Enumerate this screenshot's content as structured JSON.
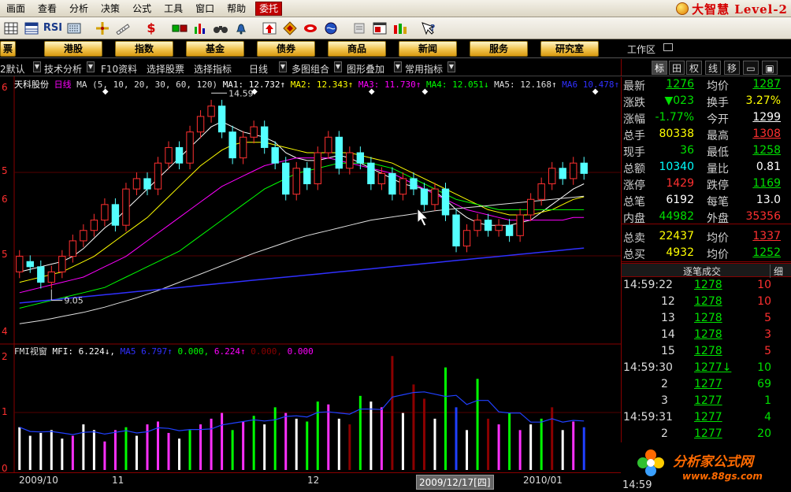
{
  "menu": {
    "items": [
      "画面",
      "查看",
      "分析",
      "决策",
      "公式",
      "工具",
      "窗口",
      "帮助"
    ],
    "active_item": "委托"
  },
  "brand": {
    "name": "大智慧 Level-2"
  },
  "toolbar": {
    "rsi_label": "RSI",
    "dollar_label": "$",
    "icons": [
      "grid-icon",
      "table-icon",
      "rsi-icon",
      "keyboard-icon",
      "crosshair-icon",
      "ruler-icon",
      "dollar-icon",
      "boxes-icon",
      "bar-chart-icon",
      "binoculars-icon",
      "bell-icon",
      "arrow-up-icon",
      "diamond-icon",
      "leaf-icon",
      "globe-icon",
      "notepad-icon",
      "window-icon",
      "stacked-bars-icon",
      "help-icon"
    ]
  },
  "nav": {
    "left_label": "票",
    "categories": [
      "港股",
      "指数",
      "基金",
      "债券",
      "商品",
      "新闻",
      "服务",
      "研究室"
    ],
    "workspace_label": "工作区"
  },
  "funcbar": {
    "items": [
      "2默认",
      "技术分析",
      "F10资料",
      "选择股票",
      "选择指标",
      "日线",
      "多图组合",
      "图形叠加",
      "常用指标"
    ]
  },
  "right_tabs": [
    "标",
    "田",
    "权",
    "线",
    "移"
  ],
  "chart_header": {
    "stock_name": "天科股份",
    "period": "日线",
    "ma_params": "MA (5, 10, 20, 30, 60, 120)",
    "ma1": "MA1: 12.732↑",
    "ma2": "MA2: 12.343↑",
    "ma3": "MA3: 11.730↑",
    "ma4": "MA4: 12.051↓",
    "ma5": "MA5: 12.168↑",
    "ma6": "MA6  10.478↑",
    "high_label": "14.59",
    "low_label": "9.05",
    "colors": {
      "ma1": "#ffffff",
      "ma2": "#ffff00",
      "ma3": "#ff00ff",
      "ma4": "#00ff00",
      "ma5": "#e0e0e0",
      "ma6": "#3030ff"
    }
  },
  "y_axis_labels": [
    "6",
    "5",
    "6",
    "5",
    "4"
  ],
  "volume_header": {
    "name": "FMI视窗",
    "mfi": "MFI: 6.224↓,",
    "ma5": "MA5  6.797↑",
    "v1": "0.000,",
    "v2": "6.224↑",
    "v3": "0.000,",
    "v4": "0.000"
  },
  "volume_axis_labels": [
    "2",
    "1",
    "0"
  ],
  "dates": {
    "labels": [
      "2009/10",
      "11",
      "12",
      "2010/01"
    ],
    "cursor": "2009/12/17[四]"
  },
  "quote": {
    "rows": [
      {
        "l1": "最新",
        "v1": "1276",
        "c1": "green",
        "l2": "均价",
        "v2": "1287",
        "c2": "green"
      },
      {
        "l1": "涨跌",
        "v1": "▼023",
        "c1": "green",
        "l2": "换手",
        "v2": "3.27%",
        "c2": "yellow"
      },
      {
        "l1": "涨幅",
        "v1": "-1.77%",
        "c1": "green",
        "l2": "今开",
        "v2": "1299",
        "c2": "white"
      },
      {
        "l1": "总手",
        "v1": "80338",
        "c1": "yellow",
        "l2": "最高",
        "v2": "1308",
        "c2": "red"
      },
      {
        "l1": "现手",
        "v1": "36",
        "c1": "green",
        "l2": "最低",
        "v2": "1258",
        "c2": "green"
      },
      {
        "l1": "总额",
        "v1": "10340",
        "c1": "cyan",
        "l2": "量比",
        "v2": "0.81",
        "c2": "white"
      },
      {
        "l1": "涨停",
        "v1": "1429",
        "c1": "red",
        "l2": "跌停",
        "v2": "1169",
        "c2": "green"
      },
      {
        "l1": "总笔",
        "v1": "6192",
        "c1": "white",
        "l2": "每笔",
        "v2": "13.0",
        "c2": "white"
      },
      {
        "l1": "内盘",
        "v1": "44982",
        "c1": "green",
        "l2": "外盘",
        "v2": "35356",
        "c2": "red"
      },
      {
        "l1": "总卖",
        "v1": "22437",
        "c1": "yellow",
        "l2": "均价",
        "v2": "1337",
        "c2": "red"
      },
      {
        "l1": "总买",
        "v1": "4932",
        "c1": "yellow",
        "l2": "均价",
        "v2": "1252",
        "c2": "green"
      }
    ]
  },
  "ticks": {
    "title": "逐笔成交",
    "detail": "细",
    "rows": [
      {
        "time": "14:59:22",
        "price": "1278",
        "vol": "10",
        "vc": "red"
      },
      {
        "time": "12",
        "price": "1278",
        "vol": "10",
        "vc": "red"
      },
      {
        "time": "13",
        "price": "1278",
        "vol": "5",
        "vc": "red"
      },
      {
        "time": "14",
        "price": "1278",
        "vol": "3",
        "vc": "red"
      },
      {
        "time": "15",
        "price": "1278",
        "vol": "5",
        "vc": "red"
      },
      {
        "time": "14:59:30",
        "price": "1277↓",
        "vol": "10",
        "vc": "green"
      },
      {
        "time": "2",
        "price": "1277",
        "vol": "69",
        "vc": "green"
      },
      {
        "time": "3",
        "price": "1277",
        "vol": "1",
        "vc": "green"
      },
      {
        "time": "14:59:31",
        "price": "1277",
        "vol": "4",
        "vc": "green"
      },
      {
        "time": "2",
        "price": "1277",
        "vol": "20",
        "vc": "green"
      }
    ],
    "bottom_time": "14:59"
  },
  "watermark": {
    "title": "分析家公式网",
    "url": "www.88gs.com"
  },
  "chart_data": {
    "type": "candlestick",
    "candles": [
      {
        "o": 11.3,
        "c": 11.6
      },
      {
        "o": 11.5,
        "c": 11.4
      },
      {
        "o": 11.4,
        "c": 11.1
      },
      {
        "o": 11.1,
        "c": 11.3
      },
      {
        "o": 11.3,
        "c": 11.6
      },
      {
        "o": 11.6,
        "c": 11.9
      },
      {
        "o": 11.9,
        "c": 12.1
      },
      {
        "o": 12.1,
        "c": 12.3
      },
      {
        "o": 12.3,
        "c": 12.6
      },
      {
        "o": 12.6,
        "c": 12.2
      },
      {
        "o": 12.2,
        "c": 12.9
      },
      {
        "o": 12.9,
        "c": 13.1
      },
      {
        "o": 13.1,
        "c": 12.9
      },
      {
        "o": 12.9,
        "c": 13.4
      },
      {
        "o": 13.4,
        "c": 13.7
      },
      {
        "o": 13.7,
        "c": 13.4
      },
      {
        "o": 13.4,
        "c": 14.0
      },
      {
        "o": 14.0,
        "c": 14.3
      },
      {
        "o": 14.3,
        "c": 14.5
      },
      {
        "o": 14.5,
        "c": 14.0
      },
      {
        "o": 14.0,
        "c": 13.5
      },
      {
        "o": 13.5,
        "c": 13.9
      },
      {
        "o": 13.9,
        "c": 14.1
      },
      {
        "o": 14.1,
        "c": 13.7
      },
      {
        "o": 13.7,
        "c": 13.4
      },
      {
        "o": 13.4,
        "c": 12.8
      },
      {
        "o": 12.8,
        "c": 13.3
      },
      {
        "o": 13.3,
        "c": 13.0
      },
      {
        "o": 13.0,
        "c": 13.6
      },
      {
        "o": 13.6,
        "c": 13.9
      },
      {
        "o": 13.9,
        "c": 13.3
      },
      {
        "o": 13.3,
        "c": 13.6
      },
      {
        "o": 13.6,
        "c": 13.4
      },
      {
        "o": 13.4,
        "c": 13.0
      },
      {
        "o": 13.0,
        "c": 13.2
      },
      {
        "o": 13.2,
        "c": 12.8
      },
      {
        "o": 12.8,
        "c": 13.1
      },
      {
        "o": 13.1,
        "c": 12.9
      },
      {
        "o": 12.9,
        "c": 12.6
      },
      {
        "o": 12.6,
        "c": 12.9
      },
      {
        "o": 12.9,
        "c": 12.4
      },
      {
        "o": 12.4,
        "c": 11.8
      },
      {
        "o": 11.8,
        "c": 12.1
      },
      {
        "o": 12.1,
        "c": 12.3
      },
      {
        "o": 12.3,
        "c": 12.1
      },
      {
        "o": 12.1,
        "c": 12.2
      },
      {
        "o": 12.2,
        "c": 12.0
      },
      {
        "o": 12.0,
        "c": 12.4
      },
      {
        "o": 12.4,
        "c": 12.7
      },
      {
        "o": 12.7,
        "c": 13.0
      },
      {
        "o": 13.0,
        "c": 13.3
      },
      {
        "o": 13.3,
        "c": 13.1
      },
      {
        "o": 13.1,
        "c": 13.4
      },
      {
        "o": 13.4,
        "c": 13.2
      }
    ],
    "ma_lines": [
      {
        "name": "MA1",
        "color": "#ffffff",
        "values": [
          11.3,
          11.35,
          11.4,
          11.45,
          11.5,
          11.6,
          11.75,
          11.95,
          12.15,
          12.3,
          12.5,
          12.7,
          12.9,
          13.1,
          13.3,
          13.5,
          13.7,
          13.9,
          14.1,
          14.2,
          14.1,
          14.0,
          13.95,
          13.9,
          13.8,
          13.6,
          13.5,
          13.45,
          13.45,
          13.5,
          13.55,
          13.5,
          13.4,
          13.3,
          13.2,
          13.1,
          13.0,
          12.95,
          12.9,
          12.85,
          12.7,
          12.5,
          12.35,
          12.25,
          12.2,
          12.2,
          12.2,
          12.25,
          12.3,
          12.45,
          12.6,
          12.75,
          12.9,
          13.0
        ]
      },
      {
        "name": "MA2",
        "color": "#ffff00",
        "values": [
          11.1,
          11.15,
          11.2,
          11.25,
          11.3,
          11.4,
          11.5,
          11.6,
          11.75,
          11.9,
          12.05,
          12.2,
          12.35,
          12.55,
          12.75,
          12.95,
          13.15,
          13.35,
          13.5,
          13.65,
          13.75,
          13.8,
          13.8,
          13.8,
          13.75,
          13.7,
          13.65,
          13.6,
          13.6,
          13.6,
          13.6,
          13.6,
          13.55,
          13.5,
          13.45,
          13.4,
          13.3,
          13.2,
          13.1,
          13.0,
          12.9,
          12.8,
          12.7,
          12.6,
          12.5,
          12.45,
          12.4,
          12.4,
          12.4,
          12.45,
          12.5,
          12.6,
          12.7,
          12.75
        ]
      },
      {
        "name": "MA3",
        "color": "#ff00ff",
        "values": [
          10.9,
          10.95,
          11.0,
          11.05,
          11.1,
          11.15,
          11.2,
          11.3,
          11.4,
          11.5,
          11.6,
          11.75,
          11.9,
          12.05,
          12.2,
          12.35,
          12.5,
          12.65,
          12.8,
          12.95,
          13.05,
          13.15,
          13.25,
          13.35,
          13.4,
          13.45,
          13.5,
          13.5,
          13.5,
          13.5,
          13.45,
          13.4,
          13.35,
          13.3,
          13.25,
          13.2,
          13.1,
          13.0,
          12.9,
          12.8,
          12.7,
          12.6,
          12.5,
          12.45,
          12.4,
          12.35,
          12.3,
          12.3,
          12.3,
          12.3,
          12.3,
          12.3,
          12.35,
          12.35
        ]
      },
      {
        "name": "MA4",
        "color": "#00ff00",
        "values": [
          10.6,
          10.65,
          10.7,
          10.75,
          10.8,
          10.85,
          10.9,
          10.95,
          11.0,
          11.1,
          11.2,
          11.3,
          11.4,
          11.5,
          11.6,
          11.7,
          11.85,
          12.0,
          12.15,
          12.3,
          12.45,
          12.6,
          12.75,
          12.9,
          13.0,
          13.1,
          13.2,
          13.25,
          13.3,
          13.35,
          13.4,
          13.4,
          13.4,
          13.4,
          13.35,
          13.3,
          13.2,
          13.1,
          13.0,
          12.9,
          12.8,
          12.7,
          12.65,
          12.6,
          12.55,
          12.5,
          12.5,
          12.5,
          12.5,
          12.5,
          12.5,
          12.5,
          12.5,
          12.5
        ]
      },
      {
        "name": "MA5",
        "color": "#e0e0e0",
        "values": [
          10.3,
          10.33,
          10.36,
          10.4,
          10.44,
          10.48,
          10.52,
          10.57,
          10.62,
          10.68,
          10.74,
          10.8,
          10.87,
          10.94,
          11.02,
          11.1,
          11.18,
          11.26,
          11.34,
          11.42,
          11.5,
          11.58,
          11.66,
          11.73,
          11.8,
          11.87,
          11.94,
          12.0,
          12.05,
          12.1,
          12.15,
          12.2,
          12.25,
          12.3,
          12.33,
          12.36,
          12.39,
          12.42,
          12.45,
          12.48,
          12.5,
          12.52,
          12.54,
          12.56,
          12.58,
          12.6,
          12.62,
          12.64,
          12.66,
          12.68,
          12.7,
          12.72,
          12.74,
          12.76
        ]
      },
      {
        "name": "MA6",
        "color": "#3030ff",
        "values": [
          10.7,
          10.72,
          10.74,
          10.76,
          10.78,
          10.8,
          10.82,
          10.84,
          10.86,
          10.88,
          10.9,
          10.92,
          10.94,
          10.96,
          10.98,
          11.0,
          11.02,
          11.04,
          11.06,
          11.08,
          11.1,
          11.12,
          11.14,
          11.16,
          11.18,
          11.2,
          11.22,
          11.24,
          11.26,
          11.28,
          11.3,
          11.32,
          11.34,
          11.36,
          11.38,
          11.4,
          11.42,
          11.44,
          11.46,
          11.48,
          11.5,
          11.52,
          11.54,
          11.56,
          11.58,
          11.6,
          11.62,
          11.64,
          11.66,
          11.68,
          11.7,
          11.72,
          11.74,
          11.76
        ]
      }
    ],
    "ylim": [
      10.0,
      14.8
    ],
    "bars": [
      {
        "v": 0.75,
        "c": "#ffffff"
      },
      {
        "v": 0.6,
        "c": "#ffffff"
      },
      {
        "v": 0.65,
        "c": "#ffffff"
      },
      {
        "v": 0.7,
        "c": "#ffffff"
      },
      {
        "v": 0.55,
        "c": "#ffffff"
      },
      {
        "v": 0.6,
        "c": "#ff30ff"
      },
      {
        "v": 0.8,
        "c": "#ffffff"
      },
      {
        "v": 0.7,
        "c": "#ffffff"
      },
      {
        "v": 0.5,
        "c": "#ff30ff"
      },
      {
        "v": 0.7,
        "c": "#ff30ff"
      },
      {
        "v": 0.75,
        "c": "#00ff00"
      },
      {
        "v": 0.6,
        "c": "#ffffff"
      },
      {
        "v": 0.8,
        "c": "#ff30ff"
      },
      {
        "v": 0.85,
        "c": "#ff30ff"
      },
      {
        "v": 0.65,
        "c": "#ff30ff"
      },
      {
        "v": 0.55,
        "c": "#ffffff"
      },
      {
        "v": 0.7,
        "c": "#00ff00"
      },
      {
        "v": 0.8,
        "c": "#ff30ff"
      },
      {
        "v": 0.9,
        "c": "#ff30ff"
      },
      {
        "v": 1.0,
        "c": "#ff30ff"
      },
      {
        "v": 0.7,
        "c": "#00ff00"
      },
      {
        "v": 0.85,
        "c": "#ff30ff"
      },
      {
        "v": 0.95,
        "c": "#00ff00"
      },
      {
        "v": 0.8,
        "c": "#ffffff"
      },
      {
        "v": 1.1,
        "c": "#00ff00"
      },
      {
        "v": 1.0,
        "c": "#ff30ff"
      },
      {
        "v": 0.9,
        "c": "#ffffff"
      },
      {
        "v": 0.85,
        "c": "#00ff00"
      },
      {
        "v": 1.2,
        "c": "#00ff00"
      },
      {
        "v": 1.15,
        "c": "#ff30ff"
      },
      {
        "v": 0.9,
        "c": "#ffffff"
      },
      {
        "v": 0.8,
        "c": "#8b0000"
      },
      {
        "v": 1.3,
        "c": "#00ff00"
      },
      {
        "v": 1.2,
        "c": "#ffffff"
      },
      {
        "v": 1.1,
        "c": "#ff30ff"
      },
      {
        "v": 2.0,
        "c": "#8b0000"
      },
      {
        "v": 1.0,
        "c": "#ffffff"
      },
      {
        "v": 1.5,
        "c": "#8b0000"
      },
      {
        "v": 1.25,
        "c": "#8b0000"
      },
      {
        "v": 0.9,
        "c": "#ffffff"
      },
      {
        "v": 1.8,
        "c": "#00ff00"
      },
      {
        "v": 1.1,
        "c": "#2040ff"
      },
      {
        "v": 0.7,
        "c": "#ffffff"
      },
      {
        "v": 1.6,
        "c": "#00ff00"
      },
      {
        "v": 0.9,
        "c": "#8b0000"
      },
      {
        "v": 0.8,
        "c": "#ff30ff"
      },
      {
        "v": 1.0,
        "c": "#00ff00"
      },
      {
        "v": 0.7,
        "c": "#ff30ff"
      },
      {
        "v": 0.8,
        "c": "#ffffff"
      },
      {
        "v": 0.9,
        "c": "#00ff00"
      },
      {
        "v": 1.1,
        "c": "#8b0000"
      },
      {
        "v": 0.7,
        "c": "#ffffff"
      },
      {
        "v": 0.85,
        "c": "#ff30ff"
      },
      {
        "v": 0.75,
        "c": "#2040ff"
      }
    ],
    "vol_ylim": [
      0,
      2.1
    ]
  }
}
